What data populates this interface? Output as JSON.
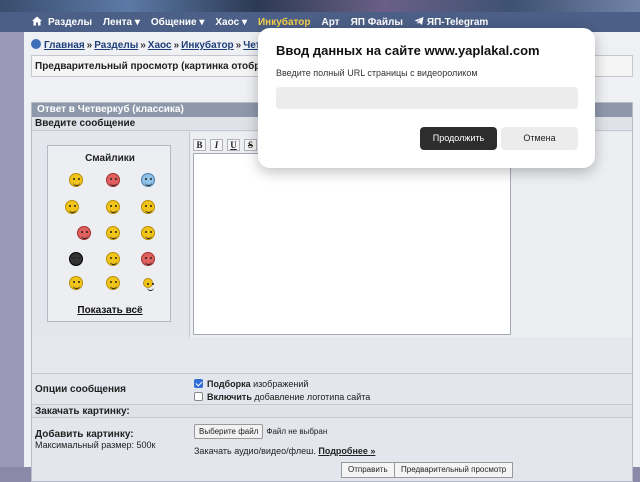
{
  "topnav": {
    "items": [
      "Разделы",
      "Лента ▾",
      "Общение ▾",
      "Хаос ▾",
      "Инкубатор",
      "Арт",
      "ЯП Файлы",
      "ЯП-Telegram"
    ]
  },
  "breadcrumb": {
    "items": [
      "Главная",
      "Разделы",
      "Хаос",
      "Инкубатор",
      "Четве"
    ]
  },
  "preview_bar": {
    "text": "Предварительный просмотр (картинка отобразит"
  },
  "form": {
    "header": "Ответ в Четверкуб (классика)",
    "message_label": "Введите сообщение",
    "smileys_title": "Смайлики",
    "show_all": "Показать всё",
    "toolbar": [
      "B",
      "I",
      "U",
      "S"
    ],
    "options_label": "Опции сообщения",
    "option1_bold": "Подборка",
    "option1_rest": " изображений",
    "option2_bold": "Включить",
    "option2_rest": " добавление логотипа сайта",
    "upload_header": "Закачать картинку:",
    "add_picture": "Добавить картинку:",
    "max_size": "Максимальный размер: 500к",
    "file_button": "Выберите файл",
    "file_status": "Файл не выбран",
    "audio_text": "Закачать аудио/видео/флеш. ",
    "audio_link": "Подробнее »",
    "submit": "Отправить",
    "preview": "Предварительный просмотр"
  },
  "dialog": {
    "title": "Ввод данных на сайте www.yaplakal.com",
    "subtitle": "Введите полный URL страницы с видеороликом",
    "input_value": "",
    "ok_label": "Продолжить",
    "cancel_label": "Отмена"
  }
}
